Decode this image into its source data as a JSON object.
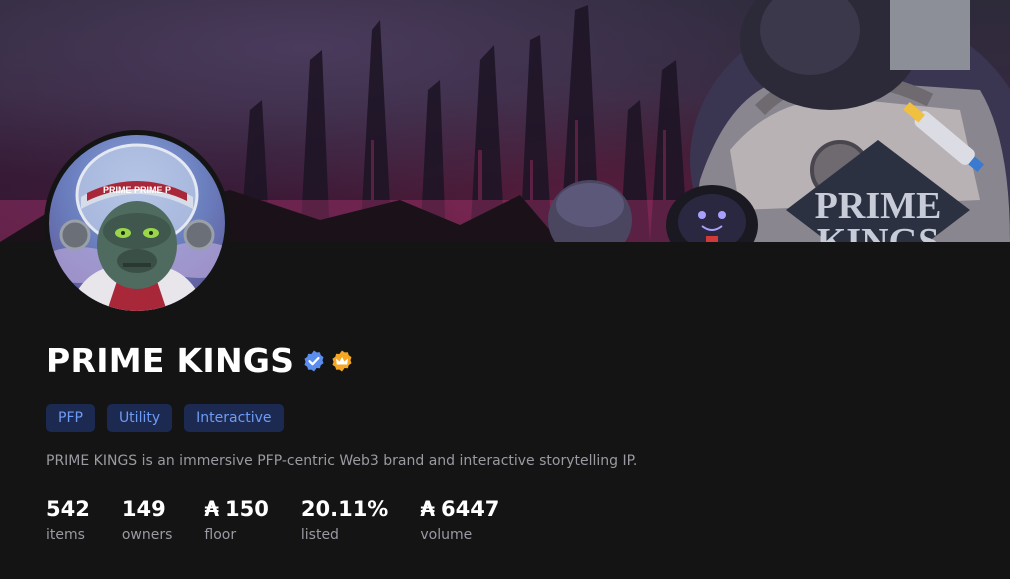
{
  "collection": {
    "name": "PRIME KINGS",
    "verified_icon": "verified-badge-icon",
    "crown_icon": "crown-badge-icon",
    "tags": [
      "PFP",
      "Utility",
      "Interactive"
    ],
    "description": "PRIME KINGS is an immersive PFP-centric Web3 brand and interactive storytelling IP.",
    "banner_text": [
      "PRIME",
      "KINGS"
    ],
    "avatar_helmet_text": "PRIME PRIME P"
  },
  "stats": {
    "items": {
      "value": "542",
      "label": "items"
    },
    "owners": {
      "value": "149",
      "label": "owners"
    },
    "floor": {
      "value": "150",
      "label": "floor",
      "currency": "₳"
    },
    "listed": {
      "value": "20.11%",
      "label": "listed"
    },
    "volume": {
      "value": "6447",
      "label": "volume",
      "currency": "₳"
    }
  },
  "colors": {
    "background": "#141414",
    "tag_bg": "#1c2a52",
    "tag_text": "#6e9cf5",
    "verified": "#5b8def",
    "crown": "#f5a623",
    "muted_text": "#9a9aa2"
  }
}
